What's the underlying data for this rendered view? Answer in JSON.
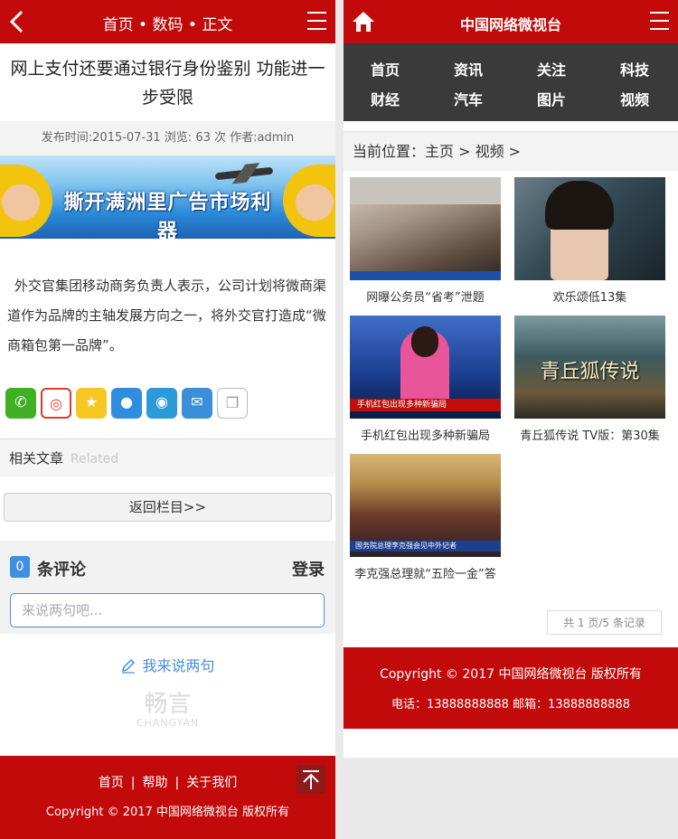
{
  "left": {
    "header": {
      "title": "首页 • 数码 • 正文"
    },
    "article": {
      "title": "网上支付还要通过银行身份鉴别 功能进一步受限",
      "meta": "发布时间:2015-07-31  浏览: 63 次  作者:admin",
      "banner_text": "撕开满洲里广告市场利器",
      "body": "外交官集团移动商务负责人表示，公司计划将微商渠道作为品牌的主轴发展方向之一，将外交官打造成“微商箱包第一品牌”。"
    },
    "share_icons": [
      "wechat-icon",
      "weibo-icon",
      "qzone-icon",
      "qq-icon",
      "tencent-weibo-icon",
      "mail-icon",
      "copy-icon"
    ],
    "related": {
      "label": "相关文章",
      "en": "Related"
    },
    "back_button": "返回栏目>>",
    "comments": {
      "count": "0",
      "label": "条评论",
      "login": "登录",
      "placeholder": "来说两句吧...",
      "speak": "我来说两句",
      "logo_cn": "畅言",
      "logo_en": "CHANGYAN"
    },
    "footer": {
      "links": [
        "首页",
        "帮助",
        "关于我们"
      ],
      "copyright": "Copyright © 2017 中国网络微视台 版权所有"
    }
  },
  "right": {
    "header": {
      "title": "中国网络微视台"
    },
    "nav": [
      "首页",
      "资讯",
      "关注",
      "科技",
      "财经",
      "汽车",
      "图片",
      "视频"
    ],
    "breadcrumb": "当前位置：主页 > 视频 >",
    "videos": [
      {
        "caption": "网曝公务员“省考”泄题"
      },
      {
        "caption": "欢乐颂低13集"
      },
      {
        "caption": "手机红包出现多种新骗局",
        "overlay": "手机红包出现多种新骗局"
      },
      {
        "caption": "青丘狐传说 TV版：第30集",
        "overlay": "青丘狐传说"
      },
      {
        "caption": "李克强总理就“五险一金”答",
        "overlay": "国务院总理李克强会见中外记者"
      }
    ],
    "pager": "共 1 页/5 条记录",
    "footer": {
      "copyright": "Copyright © 2017 中国网络微视台 版权所有",
      "contact": "电话：13888888888 邮箱：13888888888"
    }
  },
  "colors": {
    "brand_red": "#c30a0b",
    "nav_dark": "#3a3a3a",
    "accent_blue": "#3f8fe3"
  }
}
